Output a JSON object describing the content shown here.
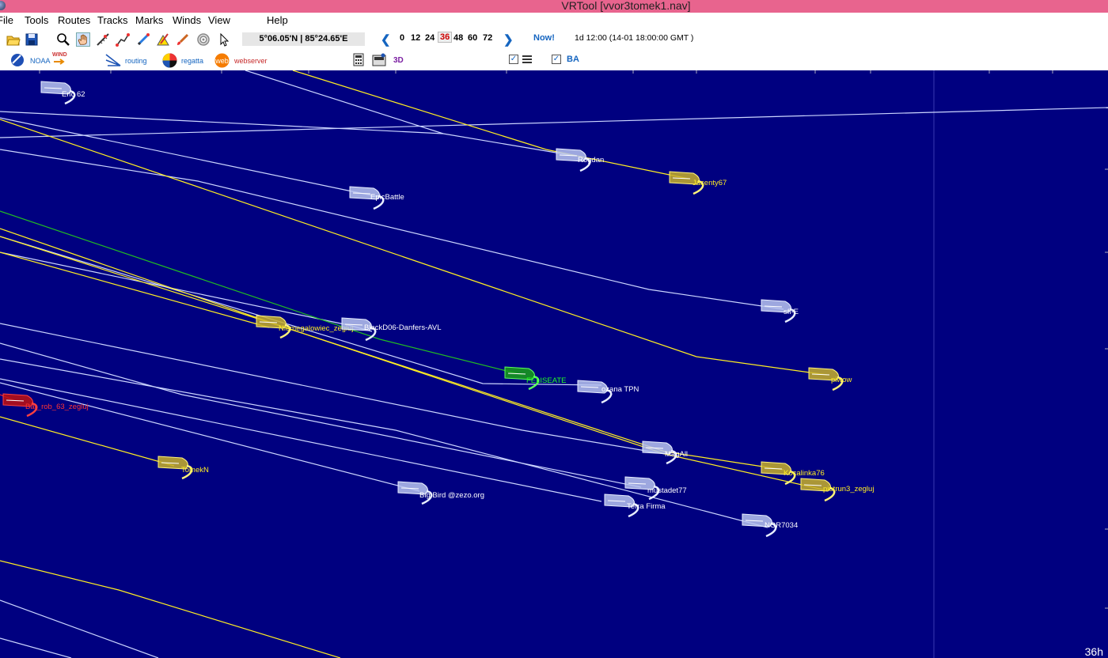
{
  "window": {
    "title": "VRTool [vvor3tomek1.nav]"
  },
  "menu": [
    "File",
    "Tools",
    "Routes",
    "Tracks",
    "Marks",
    "Winds",
    "View",
    "Help"
  ],
  "toolbar": {
    "coordinates": "5°06.05'N | 85°24.65'E",
    "time_steps": [
      "0",
      "12",
      "24",
      "36",
      "48",
      "60",
      "72"
    ],
    "selected_step": "36",
    "now_label": "Now!",
    "time_info": "1d 12:00 (14-01 18:00:00 GMT )",
    "noaa_label": "NOAA",
    "wind_label": "WIND",
    "routing_label": "routing",
    "regatta_label": "regatta",
    "webserver_label": "webserver",
    "label_3d": "3D",
    "ba_label": "BA",
    "check_mark": "✓"
  },
  "map": {
    "time_label": "36h",
    "colors": {
      "sea": "#000080",
      "track_white": "#ccd6ff",
      "track_yellow": "#ffee22",
      "track_green": "#22bb22",
      "track_red": "#ff2222"
    },
    "boats": [
      {
        "name": "Eric 62",
        "color": "white"
      },
      {
        "name": "Rogdan",
        "color": "white"
      },
      {
        "name": "Jacenty67",
        "color": "yellow"
      },
      {
        "name": "EpicBattle",
        "color": "white"
      },
      {
        "name": "sfl-E",
        "color": "white"
      },
      {
        "name": "Niemegalowiec_zegluj",
        "color": "yellow"
      },
      {
        "name": "BlackD06-Danfers-AVL",
        "color": "white"
      },
      {
        "name": "FELISEATE",
        "color": "green"
      },
      {
        "name": "ozana TPN",
        "color": "white"
      },
      {
        "name": "piwow",
        "color": "yellow"
      },
      {
        "name": "Bar_rob_63_zegluj",
        "color": "red"
      },
      {
        "name": "TomekN",
        "color": "yellow"
      },
      {
        "name": "MagAll",
        "color": "white"
      },
      {
        "name": "Kocalinka76",
        "color": "yellow"
      },
      {
        "name": "piotrun3_zegluj",
        "color": "yellow"
      },
      {
        "name": "mustadet77",
        "color": "white"
      },
      {
        "name": "Big Bird @zezo.org",
        "color": "white"
      },
      {
        "name": "Terra Firma",
        "color": "white"
      },
      {
        "name": "NOR7034",
        "color": "white"
      }
    ]
  }
}
